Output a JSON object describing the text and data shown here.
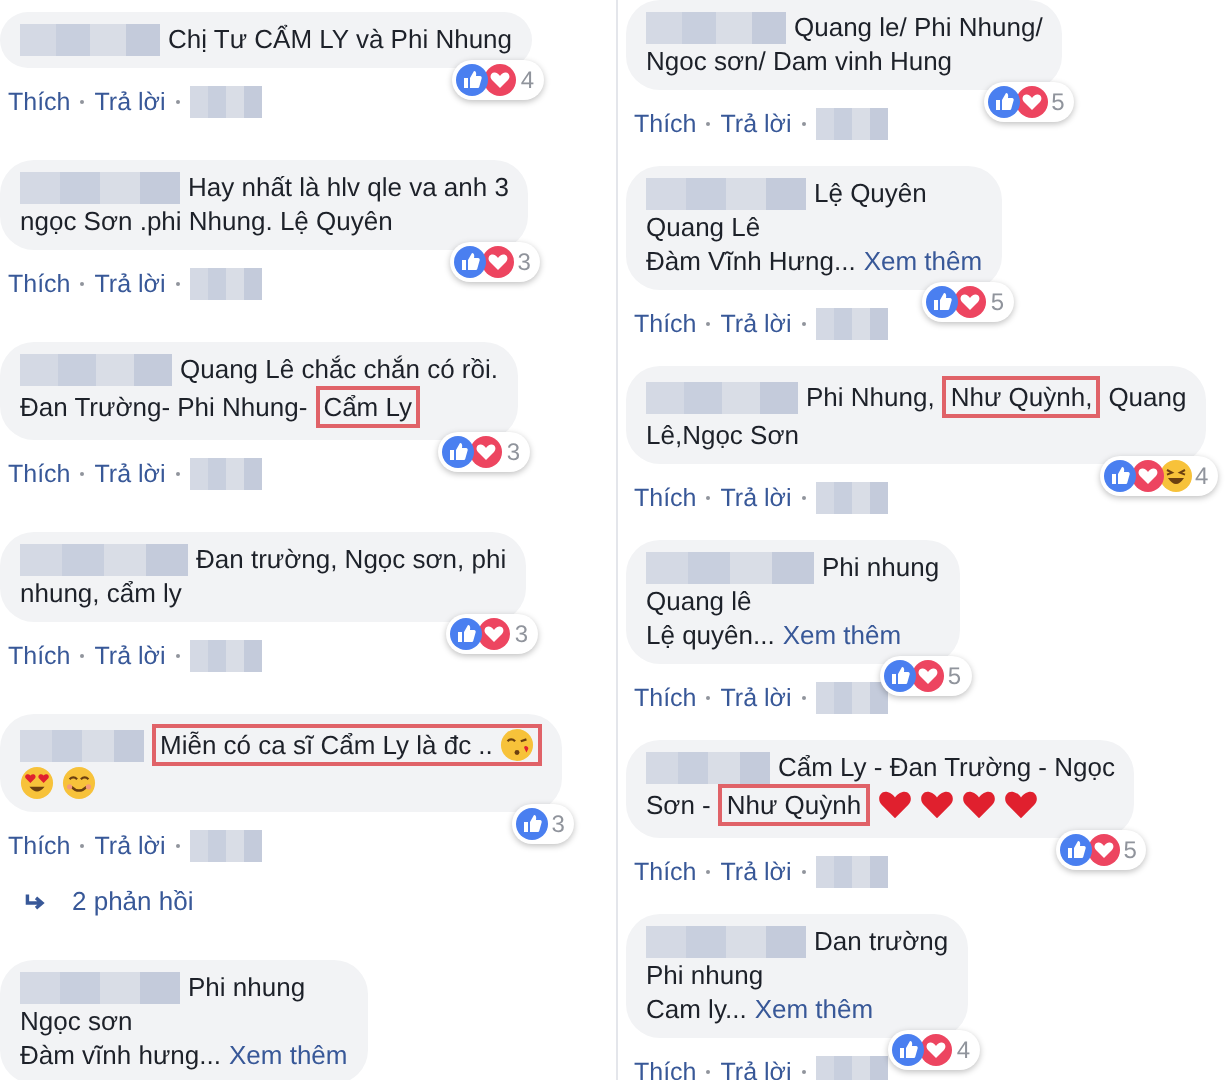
{
  "columns": [
    {
      "comments": [
        {
          "lines": [
            [
              {
                "kind": "text",
                "text": "Chị Tư CẨM LY và Phi Nhung"
              }
            ]
          ],
          "reactions": {
            "icons": [
              {
                "kind": "like"
              },
              {
                "kind": "love"
              }
            ],
            "count": "4"
          },
          "actions": [
            "Thích",
            "Trả lời"
          ]
        },
        {
          "lines": [
            [
              {
                "kind": "text",
                "text": "Hay nhất là hlv qle va anh 3"
              }
            ],
            [
              {
                "kind": "text",
                "text": "ngọc Sơn .phi Nhung. Lệ Quyên"
              }
            ]
          ],
          "reactions": {
            "icons": [
              {
                "kind": "like"
              },
              {
                "kind": "love"
              }
            ],
            "count": "3"
          },
          "actions": [
            "Thích",
            "Trả lời"
          ]
        },
        {
          "lines": [
            [
              {
                "kind": "text",
                "text": "Quang Lê chắc chắn có rồi."
              }
            ],
            [
              {
                "kind": "text",
                "text": "Đan Trường- Phi Nhung-"
              },
              {
                "kind": "highlight",
                "text": "Cẩm Ly"
              }
            ]
          ],
          "reactions": {
            "icons": [
              {
                "kind": "like"
              },
              {
                "kind": "love"
              }
            ],
            "count": "3"
          },
          "actions": [
            "Thích",
            "Trả lời"
          ]
        },
        {
          "lines": [
            [
              {
                "kind": "text",
                "text": "Đan trường, Ngọc sơn, phi"
              }
            ],
            [
              {
                "kind": "text",
                "text": "nhung, cẩm ly"
              }
            ]
          ],
          "reactions": {
            "icons": [
              {
                "kind": "like"
              },
              {
                "kind": "love"
              }
            ],
            "count": "3"
          },
          "actions": [
            "Thích",
            "Trả lời"
          ]
        },
        {
          "lines": [
            [
              {
                "kind": "highlight",
                "text": "Miễn có ca sĩ Cẩm Ly là đc ..",
                "icons": [
                  {
                    "kind": "kiss"
                  }
                ]
              }
            ],
            [
              {
                "kind": "hearteyes"
              },
              {
                "kind": "smile"
              }
            ]
          ],
          "reactions": {
            "icons": [
              {
                "kind": "like"
              }
            ],
            "count": "3"
          },
          "actions": [
            "Thích",
            "Trả lời"
          ],
          "replies": "2 phản hồi"
        },
        {
          "lines": [
            [
              {
                "kind": "text",
                "text": "Phi nhung"
              }
            ],
            [
              {
                "kind": "text",
                "text": "Ngọc sơn"
              }
            ],
            [
              {
                "kind": "text",
                "text": "Đàm vĩnh hưng..."
              },
              {
                "kind": "link",
                "text": "Xem thêm"
              }
            ]
          ]
        }
      ]
    },
    {
      "comments": [
        {
          "lines": [
            [
              {
                "kind": "text",
                "text": "Quang le/ Phi Nhung/"
              }
            ],
            [
              {
                "kind": "text",
                "text": "Ngoc sơn/ Dam vinh Hung"
              }
            ]
          ],
          "reactions": {
            "icons": [
              {
                "kind": "like"
              },
              {
                "kind": "love"
              }
            ],
            "count": "5"
          },
          "actions": [
            "Thích",
            "Trả lời"
          ]
        },
        {
          "lines": [
            [
              {
                "kind": "text",
                "text": "Lệ Quyên"
              }
            ],
            [
              {
                "kind": "text",
                "text": "Quang Lê"
              }
            ],
            [
              {
                "kind": "text",
                "text": "Đàm Vĩnh Hưng..."
              },
              {
                "kind": "link",
                "text": "Xem thêm"
              }
            ]
          ],
          "reactions": {
            "icons": [
              {
                "kind": "like"
              },
              {
                "kind": "love"
              }
            ],
            "count": "5"
          },
          "actions": [
            "Thích",
            "Trả lời"
          ]
        },
        {
          "lines": [
            [
              {
                "kind": "text",
                "text": "Phi Nhung,"
              },
              {
                "kind": "highlight",
                "text": "Như Quỳnh,"
              },
              {
                "kind": "text",
                "text": "Quang"
              }
            ],
            [
              {
                "kind": "text",
                "text": "Lê,Ngọc Sơn"
              }
            ]
          ],
          "reactions": {
            "icons": [
              {
                "kind": "like"
              },
              {
                "kind": "love"
              },
              {
                "kind": "haha"
              }
            ],
            "count": "4"
          },
          "actions": [
            "Thích",
            "Trả lời"
          ]
        },
        {
          "lines": [
            [
              {
                "kind": "text",
                "text": "Phi nhung"
              }
            ],
            [
              {
                "kind": "text",
                "text": "Quang lê"
              }
            ],
            [
              {
                "kind": "text",
                "text": "Lệ quyên..."
              },
              {
                "kind": "link",
                "text": "Xem thêm"
              }
            ]
          ],
          "reactions": {
            "icons": [
              {
                "kind": "like"
              },
              {
                "kind": "love"
              }
            ],
            "count": "5"
          },
          "actions": [
            "Thích",
            "Trả lời"
          ]
        },
        {
          "lines": [
            [
              {
                "kind": "text",
                "text": "Cẩm Ly - Đan Trường - Ngọc"
              }
            ],
            [
              {
                "kind": "text",
                "text": "Sơn -"
              },
              {
                "kind": "highlight",
                "text": "Như Quỳnh"
              },
              {
                "kind": "heart"
              },
              {
                "kind": "heart"
              },
              {
                "kind": "heart"
              },
              {
                "kind": "heart"
              }
            ]
          ],
          "reactions": {
            "icons": [
              {
                "kind": "like"
              },
              {
                "kind": "love"
              }
            ],
            "count": "5"
          },
          "actions": [
            "Thích",
            "Trả lời"
          ]
        },
        {
          "lines": [
            [
              {
                "kind": "text",
                "text": "Dan trường"
              }
            ],
            [
              {
                "kind": "text",
                "text": "Phi nhung"
              }
            ],
            [
              {
                "kind": "text",
                "text": "Cam ly..."
              },
              {
                "kind": "link",
                "text": "Xem thêm"
              }
            ]
          ],
          "reactions": {
            "icons": [
              {
                "kind": "like"
              },
              {
                "kind": "love"
              }
            ],
            "count": "4"
          },
          "actions": [
            "Thích",
            "Trả lời"
          ]
        }
      ]
    }
  ]
}
